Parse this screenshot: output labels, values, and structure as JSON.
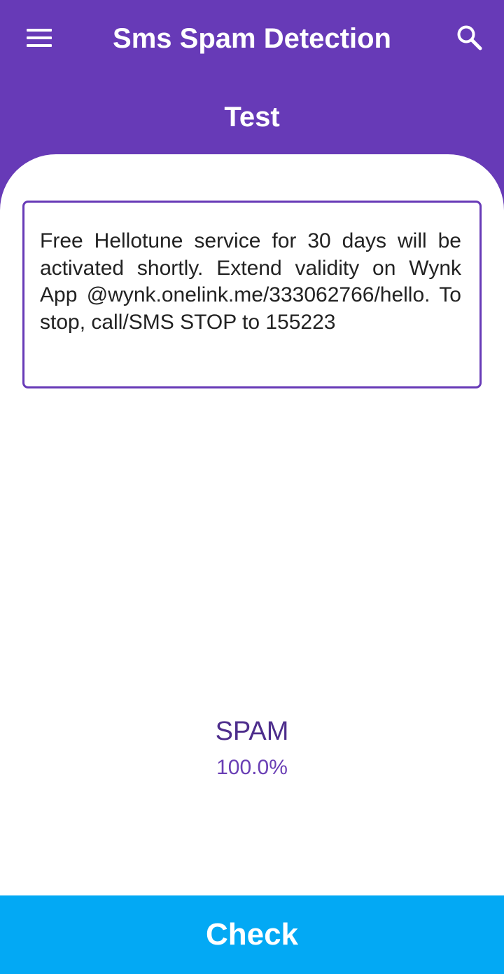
{
  "app_bar": {
    "title": "Sms Spam Detection",
    "menu_icon": "hamburger-menu-icon",
    "search_icon": "search-icon",
    "background_color": "#673ab7"
  },
  "page": {
    "heading": "Test"
  },
  "message_input": {
    "value": "Free Hellotune service for 30 days will be activated shortly. Extend validity on Wynk App  @wynk.onelink.me/333062766/hello. To stop, call/SMS STOP to 155223",
    "border_color": "#673ab7"
  },
  "result": {
    "label": "SPAM",
    "score": "100.0%"
  },
  "check_button": {
    "label": "Check",
    "background_color": "#03a9f4"
  }
}
